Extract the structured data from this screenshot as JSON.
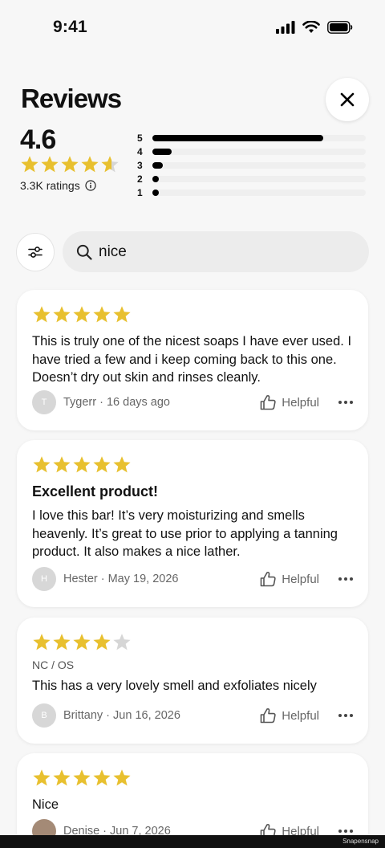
{
  "status": {
    "time": "9:41"
  },
  "header": {
    "title": "Reviews"
  },
  "summary": {
    "average": "4.6",
    "average_stars": 4.6,
    "ratings_count": "3.3K ratings"
  },
  "histogram": [
    {
      "label": "5",
      "fraction": 0.8
    },
    {
      "label": "4",
      "fraction": 0.09
    },
    {
      "label": "3",
      "fraction": 0.05
    },
    {
      "label": "2",
      "fraction": 0.025
    },
    {
      "label": "1",
      "fraction": 0.03
    }
  ],
  "search": {
    "value": "nice"
  },
  "reviews": [
    {
      "stars": 5,
      "title": "",
      "variant": "",
      "body": "This is truly one of the nicest soaps I have ever used. I have tried a few and i keep coming back to this one. Doesn’t dry out skin and rinses cleanly.",
      "avatar": "T",
      "author": "Tygerr · 16 days ago",
      "helpful": "Helpful"
    },
    {
      "stars": 5,
      "title": "Excellent product!",
      "variant": "",
      "body": "I love this bar! It’s very moisturizing and smells heavenly. It’s great to use prior to applying a tanning product. It also makes a nice lather.",
      "avatar": "H",
      "author": "Hester · May 19, 2026",
      "helpful": "Helpful"
    },
    {
      "stars": 4,
      "title": "",
      "variant": "NC / OS",
      "body": "This has a very lovely smell and exfoliates nicely",
      "avatar": "B",
      "author": "Brittany · Jun 16, 2026",
      "helpful": "Helpful"
    },
    {
      "stars": 5,
      "title": "",
      "variant": "",
      "body": "Nice",
      "avatar": "",
      "author": "Denise · Jun 7, 2026",
      "helpful": "Helpful"
    }
  ],
  "watermark": "Snapensnap",
  "colors": {
    "star": "#e8c02f",
    "star_empty": "#d6d6d6",
    "bar": "#000000",
    "track": "#efefef"
  },
  "icons": [
    "cellular-icon",
    "wifi-icon",
    "battery-icon",
    "close-icon",
    "star-icon",
    "info-icon",
    "filter-icon",
    "search-icon",
    "thumbs-up-icon",
    "more-icon"
  ]
}
